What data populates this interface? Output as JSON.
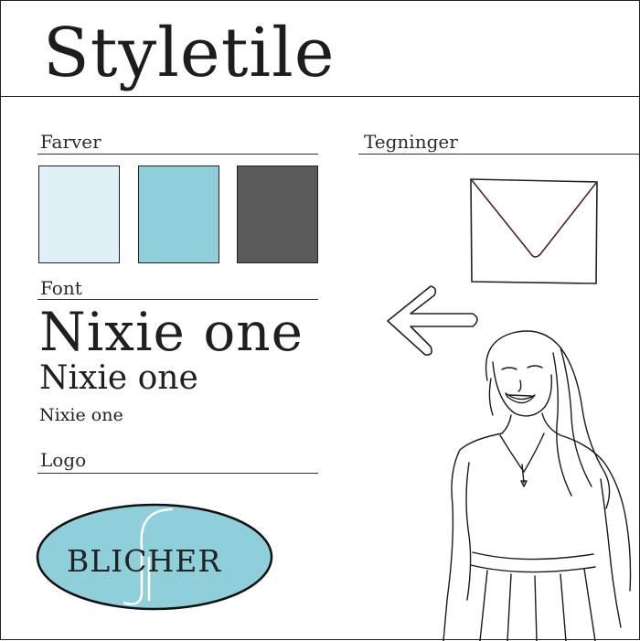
{
  "title": "Styletile",
  "sections": {
    "colors": "Farver",
    "drawings": "Tegninger",
    "font": "Font",
    "logo": "Logo"
  },
  "swatches": [
    "#dff1f6",
    "#8ecfd9",
    "#5a5a5a"
  ],
  "font_samples": {
    "large": "Nixie one",
    "medium": "Nixie one",
    "small": "Nixie one"
  },
  "logo": {
    "text": "BLICHER",
    "fill": "#8ecfd9"
  }
}
